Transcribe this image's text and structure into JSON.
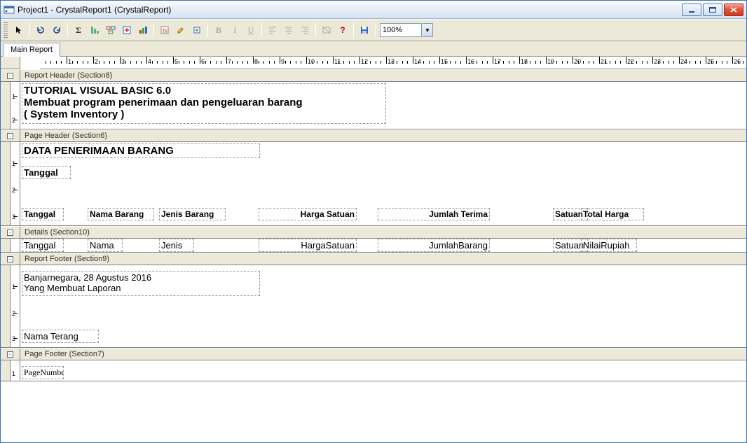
{
  "window": {
    "title": "Project1 - CrystalReport1 (CrystalReport)"
  },
  "toolbar": {
    "zoom_value": "100%"
  },
  "tab": {
    "main": "Main Report"
  },
  "sections": {
    "report_header": "Report Header (Section8)",
    "page_header": "Page Header (Section6)",
    "details": "Details (Section10)",
    "report_footer": "Report Footer (Section9)",
    "page_footer": "Page Footer (Section7)"
  },
  "report_header": {
    "line1": "TUTORIAL VISUAL BASIC 6.0",
    "line2": "Membuat program penerimaan dan pengeluaran barang",
    "line3": "( System Inventory )"
  },
  "page_header": {
    "title": "DATA PENERIMAAN BARANG",
    "tanggal_label": "Tanggal",
    "cols": {
      "tanggal": "Tanggal",
      "nama_barang": "Nama Barang",
      "jenis_barang": "Jenis Barang",
      "harga_satuan": "Harga Satuan",
      "jumlah_terima": "Jumlah Terima",
      "satuan": "Satuan",
      "total_harga": "Total Harga"
    }
  },
  "details": {
    "tanggal": "Tanggal",
    "nama": "Nama",
    "jenis": "Jenis",
    "harga_satuan": "HargaSatuan",
    "jumlah_barang": "JumlahBarang",
    "satuan": "Satuan",
    "nilai_rupiah": "NilaiRupiah"
  },
  "report_footer": {
    "place_date": "Banjarnegara, 28 Agustus 2016",
    "maker": "Yang Membuat Laporan",
    "name": "Nama Terang"
  },
  "page_footer": {
    "page": "PageNumbe"
  }
}
